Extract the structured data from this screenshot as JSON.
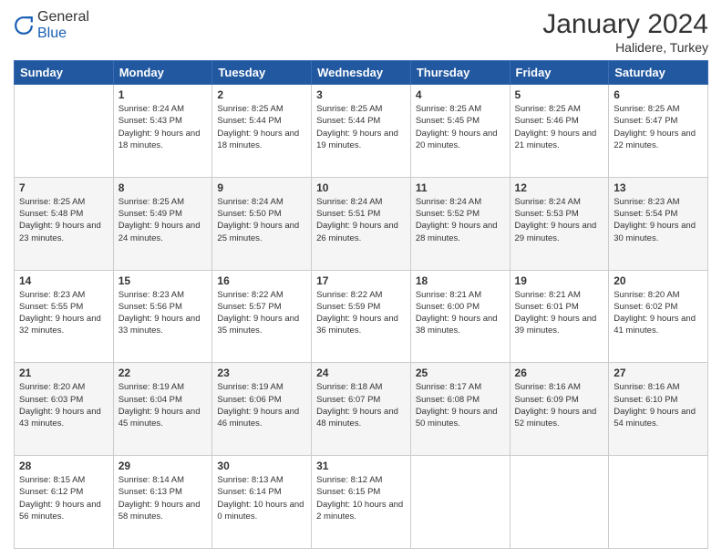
{
  "header": {
    "logo": {
      "general": "General",
      "blue": "Blue"
    },
    "title": "January 2024",
    "location": "Halidere, Turkey"
  },
  "days_of_week": [
    "Sunday",
    "Monday",
    "Tuesday",
    "Wednesday",
    "Thursday",
    "Friday",
    "Saturday"
  ],
  "weeks": [
    [
      {
        "day": "",
        "sunrise": "",
        "sunset": "",
        "daylight": ""
      },
      {
        "day": "1",
        "sunrise": "Sunrise: 8:24 AM",
        "sunset": "Sunset: 5:43 PM",
        "daylight": "Daylight: 9 hours and 18 minutes."
      },
      {
        "day": "2",
        "sunrise": "Sunrise: 8:25 AM",
        "sunset": "Sunset: 5:44 PM",
        "daylight": "Daylight: 9 hours and 18 minutes."
      },
      {
        "day": "3",
        "sunrise": "Sunrise: 8:25 AM",
        "sunset": "Sunset: 5:44 PM",
        "daylight": "Daylight: 9 hours and 19 minutes."
      },
      {
        "day": "4",
        "sunrise": "Sunrise: 8:25 AM",
        "sunset": "Sunset: 5:45 PM",
        "daylight": "Daylight: 9 hours and 20 minutes."
      },
      {
        "day": "5",
        "sunrise": "Sunrise: 8:25 AM",
        "sunset": "Sunset: 5:46 PM",
        "daylight": "Daylight: 9 hours and 21 minutes."
      },
      {
        "day": "6",
        "sunrise": "Sunrise: 8:25 AM",
        "sunset": "Sunset: 5:47 PM",
        "daylight": "Daylight: 9 hours and 22 minutes."
      }
    ],
    [
      {
        "day": "7",
        "sunrise": "Sunrise: 8:25 AM",
        "sunset": "Sunset: 5:48 PM",
        "daylight": "Daylight: 9 hours and 23 minutes."
      },
      {
        "day": "8",
        "sunrise": "Sunrise: 8:25 AM",
        "sunset": "Sunset: 5:49 PM",
        "daylight": "Daylight: 9 hours and 24 minutes."
      },
      {
        "day": "9",
        "sunrise": "Sunrise: 8:24 AM",
        "sunset": "Sunset: 5:50 PM",
        "daylight": "Daylight: 9 hours and 25 minutes."
      },
      {
        "day": "10",
        "sunrise": "Sunrise: 8:24 AM",
        "sunset": "Sunset: 5:51 PM",
        "daylight": "Daylight: 9 hours and 26 minutes."
      },
      {
        "day": "11",
        "sunrise": "Sunrise: 8:24 AM",
        "sunset": "Sunset: 5:52 PM",
        "daylight": "Daylight: 9 hours and 28 minutes."
      },
      {
        "day": "12",
        "sunrise": "Sunrise: 8:24 AM",
        "sunset": "Sunset: 5:53 PM",
        "daylight": "Daylight: 9 hours and 29 minutes."
      },
      {
        "day": "13",
        "sunrise": "Sunrise: 8:23 AM",
        "sunset": "Sunset: 5:54 PM",
        "daylight": "Daylight: 9 hours and 30 minutes."
      }
    ],
    [
      {
        "day": "14",
        "sunrise": "Sunrise: 8:23 AM",
        "sunset": "Sunset: 5:55 PM",
        "daylight": "Daylight: 9 hours and 32 minutes."
      },
      {
        "day": "15",
        "sunrise": "Sunrise: 8:23 AM",
        "sunset": "Sunset: 5:56 PM",
        "daylight": "Daylight: 9 hours and 33 minutes."
      },
      {
        "day": "16",
        "sunrise": "Sunrise: 8:22 AM",
        "sunset": "Sunset: 5:57 PM",
        "daylight": "Daylight: 9 hours and 35 minutes."
      },
      {
        "day": "17",
        "sunrise": "Sunrise: 8:22 AM",
        "sunset": "Sunset: 5:59 PM",
        "daylight": "Daylight: 9 hours and 36 minutes."
      },
      {
        "day": "18",
        "sunrise": "Sunrise: 8:21 AM",
        "sunset": "Sunset: 6:00 PM",
        "daylight": "Daylight: 9 hours and 38 minutes."
      },
      {
        "day": "19",
        "sunrise": "Sunrise: 8:21 AM",
        "sunset": "Sunset: 6:01 PM",
        "daylight": "Daylight: 9 hours and 39 minutes."
      },
      {
        "day": "20",
        "sunrise": "Sunrise: 8:20 AM",
        "sunset": "Sunset: 6:02 PM",
        "daylight": "Daylight: 9 hours and 41 minutes."
      }
    ],
    [
      {
        "day": "21",
        "sunrise": "Sunrise: 8:20 AM",
        "sunset": "Sunset: 6:03 PM",
        "daylight": "Daylight: 9 hours and 43 minutes."
      },
      {
        "day": "22",
        "sunrise": "Sunrise: 8:19 AM",
        "sunset": "Sunset: 6:04 PM",
        "daylight": "Daylight: 9 hours and 45 minutes."
      },
      {
        "day": "23",
        "sunrise": "Sunrise: 8:19 AM",
        "sunset": "Sunset: 6:06 PM",
        "daylight": "Daylight: 9 hours and 46 minutes."
      },
      {
        "day": "24",
        "sunrise": "Sunrise: 8:18 AM",
        "sunset": "Sunset: 6:07 PM",
        "daylight": "Daylight: 9 hours and 48 minutes."
      },
      {
        "day": "25",
        "sunrise": "Sunrise: 8:17 AM",
        "sunset": "Sunset: 6:08 PM",
        "daylight": "Daylight: 9 hours and 50 minutes."
      },
      {
        "day": "26",
        "sunrise": "Sunrise: 8:16 AM",
        "sunset": "Sunset: 6:09 PM",
        "daylight": "Daylight: 9 hours and 52 minutes."
      },
      {
        "day": "27",
        "sunrise": "Sunrise: 8:16 AM",
        "sunset": "Sunset: 6:10 PM",
        "daylight": "Daylight: 9 hours and 54 minutes."
      }
    ],
    [
      {
        "day": "28",
        "sunrise": "Sunrise: 8:15 AM",
        "sunset": "Sunset: 6:12 PM",
        "daylight": "Daylight: 9 hours and 56 minutes."
      },
      {
        "day": "29",
        "sunrise": "Sunrise: 8:14 AM",
        "sunset": "Sunset: 6:13 PM",
        "daylight": "Daylight: 9 hours and 58 minutes."
      },
      {
        "day": "30",
        "sunrise": "Sunrise: 8:13 AM",
        "sunset": "Sunset: 6:14 PM",
        "daylight": "Daylight: 10 hours and 0 minutes."
      },
      {
        "day": "31",
        "sunrise": "Sunrise: 8:12 AM",
        "sunset": "Sunset: 6:15 PM",
        "daylight": "Daylight: 10 hours and 2 minutes."
      },
      {
        "day": "",
        "sunrise": "",
        "sunset": "",
        "daylight": ""
      },
      {
        "day": "",
        "sunrise": "",
        "sunset": "",
        "daylight": ""
      },
      {
        "day": "",
        "sunrise": "",
        "sunset": "",
        "daylight": ""
      }
    ]
  ]
}
